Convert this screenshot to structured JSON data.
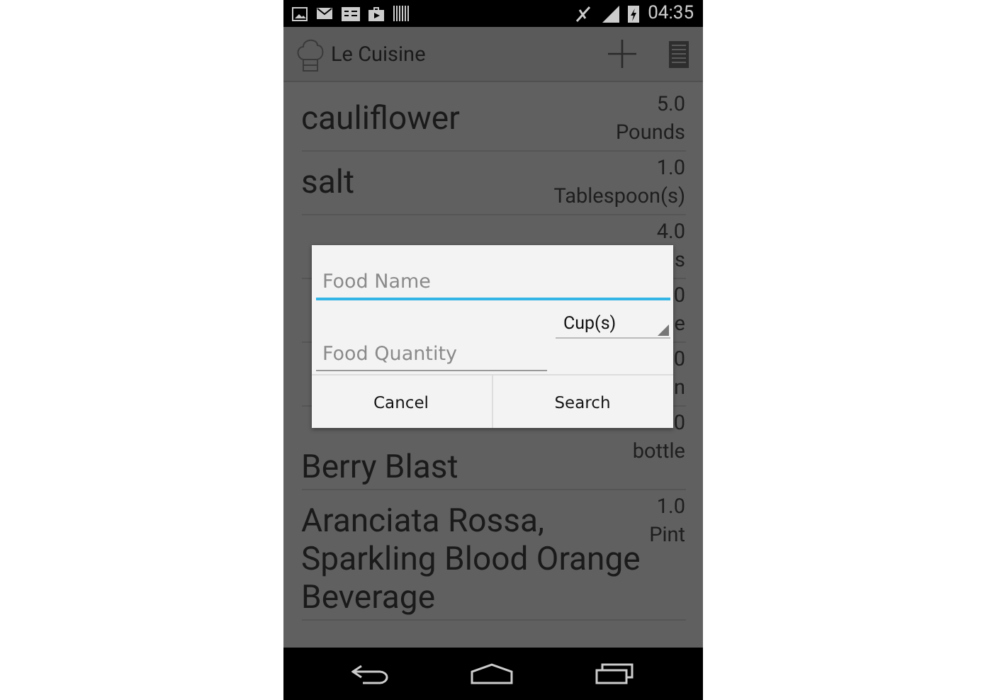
{
  "status_bar": {
    "time": "04:35"
  },
  "action_bar": {
    "title": "Le Cuisine"
  },
  "foods": [
    {
      "name": "cauliflower",
      "quantity": "5.0",
      "unit": "Pounds"
    },
    {
      "name": "salt",
      "quantity": "1.0",
      "unit": "Tablespoon(s)"
    },
    {
      "quantity": "4.0",
      "unit": "s"
    },
    {
      "quantity": "0",
      "unit": "e"
    },
    {
      "quantity": "0",
      "unit": "n"
    },
    {
      "name": "Berry Blast",
      "quantity": "0",
      "unit": "bottle"
    },
    {
      "name": "Aranciata Rossa, Sparkling Blood Orange Beverage",
      "quantity": "1.0",
      "unit": "Pint"
    }
  ],
  "dialog": {
    "name_field": {
      "placeholder": "Food Name",
      "focused": true
    },
    "unit_spinner": {
      "value": "Cup(s)"
    },
    "quantity_field": {
      "placeholder": "Food Quantity",
      "focused": false
    },
    "buttons": [
      "Cancel",
      "Search"
    ]
  }
}
